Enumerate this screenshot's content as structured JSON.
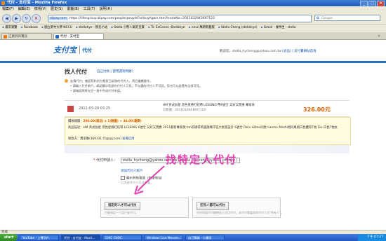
{
  "window": {
    "title": "代付 - 支付宝 - Mozilla Firefox"
  },
  "menu": [
    "檔案(F)",
    "編輯(E)",
    "檢視(V)",
    "歷史(S)",
    "書籤(B)",
    "工具(T)",
    "說明(H)"
  ],
  "nav": {
    "url_site": "alipay.com",
    "url": "https://lifeng.buy.alipay.com/people/peopleFor/buyAgain.htm?tradeNo=2011032943697123",
    "search_placeholder": "Google"
  },
  "bookmarks": [
    "最常瀏覽",
    "Facebook",
    "國立新竹大學 NCCU",
    "stellahye - 無名小站",
    "Stella 小熊人氣的百貨",
    "Ts: EsConee ;Stellahye",
    "nevz 萬朗新舊版",
    "Stella Cheng (stellahye)",
    "Gmail - 收件匣 - stella"
  ],
  "tabs": [
    {
      "label": "已買到的寶貝",
      "active": false
    },
    {
      "label": "代付 - 支付宝",
      "active": true
    }
  ],
  "page": {
    "logo": "支付宝",
    "logo_sub": "代付",
    "welcome": "歡迎您，stella_hycheng@yahoo.com.tw",
    "logout": "[退出]",
    "mall": "| 支付寶網站首頁",
    "title": "找人代付",
    "title_links": "自己付款 | 使用遇到問題?",
    "tips": [
      "友情代付，確認您和對方都是已認證的代付人，然后繼續操作。",
      "• 請輸入代付賬戶。默認顯示您設的代付人可見，不勾選的代付人不可見。您也可以設置為全部可見。",
      "• 請確認將將在這一頁中完成代付申請。"
    ],
    "order": {
      "date": "2011-03-29 03:25",
      "name": "HM 英式加星 黑色星條打結帶 LESSING 帶6號全 又好又實惠 專家休",
      "trade_no": "交易號：2011032943697123",
      "price": "326.00元"
    },
    "detail": {
      "price_label": "價格總額：",
      "price_line": "296.00(商品) x 1(數量) + 30.00(運費)",
      "desc": "商品描述：HM 英式加星 黑色星條打結帶 LESSING 6號全 又好又實惠 2011最新專家款 hm的碼帶英國旗幟印花大氣感設計 6號全 Paris Hilton同款 Lauren Moshi相同風格白色體育T恤 Tee 白色T恤女",
      "seller": "收款方：賣家聯(369331.t5@qq.com)",
      "seller_link": "查看信用"
    },
    "form": {
      "req": "*",
      "label": "代付申請人：",
      "value": "stella_hycheng@yahoo.com.tw ( stella_hycheng@yahoo.com.tw )",
      "add_link": "添加代付人賬戶",
      "check_label": "顯示其他張號（恢復地址）",
      "hint": "已添加代付人可以查看。"
    },
    "annotation": "找特定人代付",
    "choices": [
      {
        "button": "指定的人才可以代付",
        "sub": "只能指定一个用户来代付。"
      },
      {
        "button": "任何人都可以代付",
        "sub": "任何知道代付鏈接的人均可代付，本代付單當前的代付人为\"所有人\"。"
      }
    ]
  },
  "status": "完成",
  "taskbar": {
    "start": "start",
    "items": [
      "YouTube - 上傳活片",
      "代付 - 支付宝 - Mozil...",
      "CHIC CHOC",
      "Windows Live Messen...",
      "自己購買 - 小畫家"
    ],
    "clock": "下午 07:27"
  }
}
